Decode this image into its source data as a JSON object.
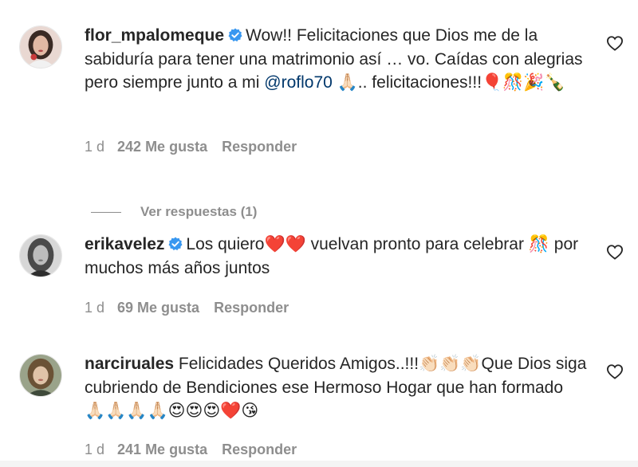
{
  "comments": [
    {
      "username": "flor_mpalomeque",
      "verified": true,
      "text_before_mention": "Wow!! Felicitaciones que Dios me de la sabiduría para tener una matrimonio así … vo. Caídas con alegrias pero siempre junto a mi",
      "mention": "@roflo70",
      "text_after_mention": "🙏🏻.. felicitaciones!!!🎈🎊🎉🍾",
      "time": "1 d",
      "likes": "242 Me gusta",
      "reply_label": "Responder",
      "view_replies": "Ver respuestas (1)"
    },
    {
      "username": "erikavelez",
      "verified": true,
      "text": "Los quiero❤️❤️ vuelvan pronto para celebrar 🎊 por muchos más años juntos",
      "time": "1 d",
      "likes": "69 Me gusta",
      "reply_label": "Responder"
    },
    {
      "username": "narciruales",
      "verified": false,
      "text": "Felicidades Queridos Amigos..!!!👏🏻👏🏻👏🏻Que Dios siga cubriendo de Bendiciones ese Hermoso Hogar que han formado 🙏🏻🙏🏻🙏🏻🙏🏻😍😍😍❤️😘",
      "time": "1 d",
      "likes": "241 Me gusta",
      "reply_label": "Responder"
    }
  ],
  "icons": {
    "like": "heart-outline-icon",
    "verified": "verified-badge-icon"
  },
  "colors": {
    "text": "#262626",
    "secondary": "#8e8e8e",
    "mention": "#00376b",
    "verified": "#3897f0"
  }
}
